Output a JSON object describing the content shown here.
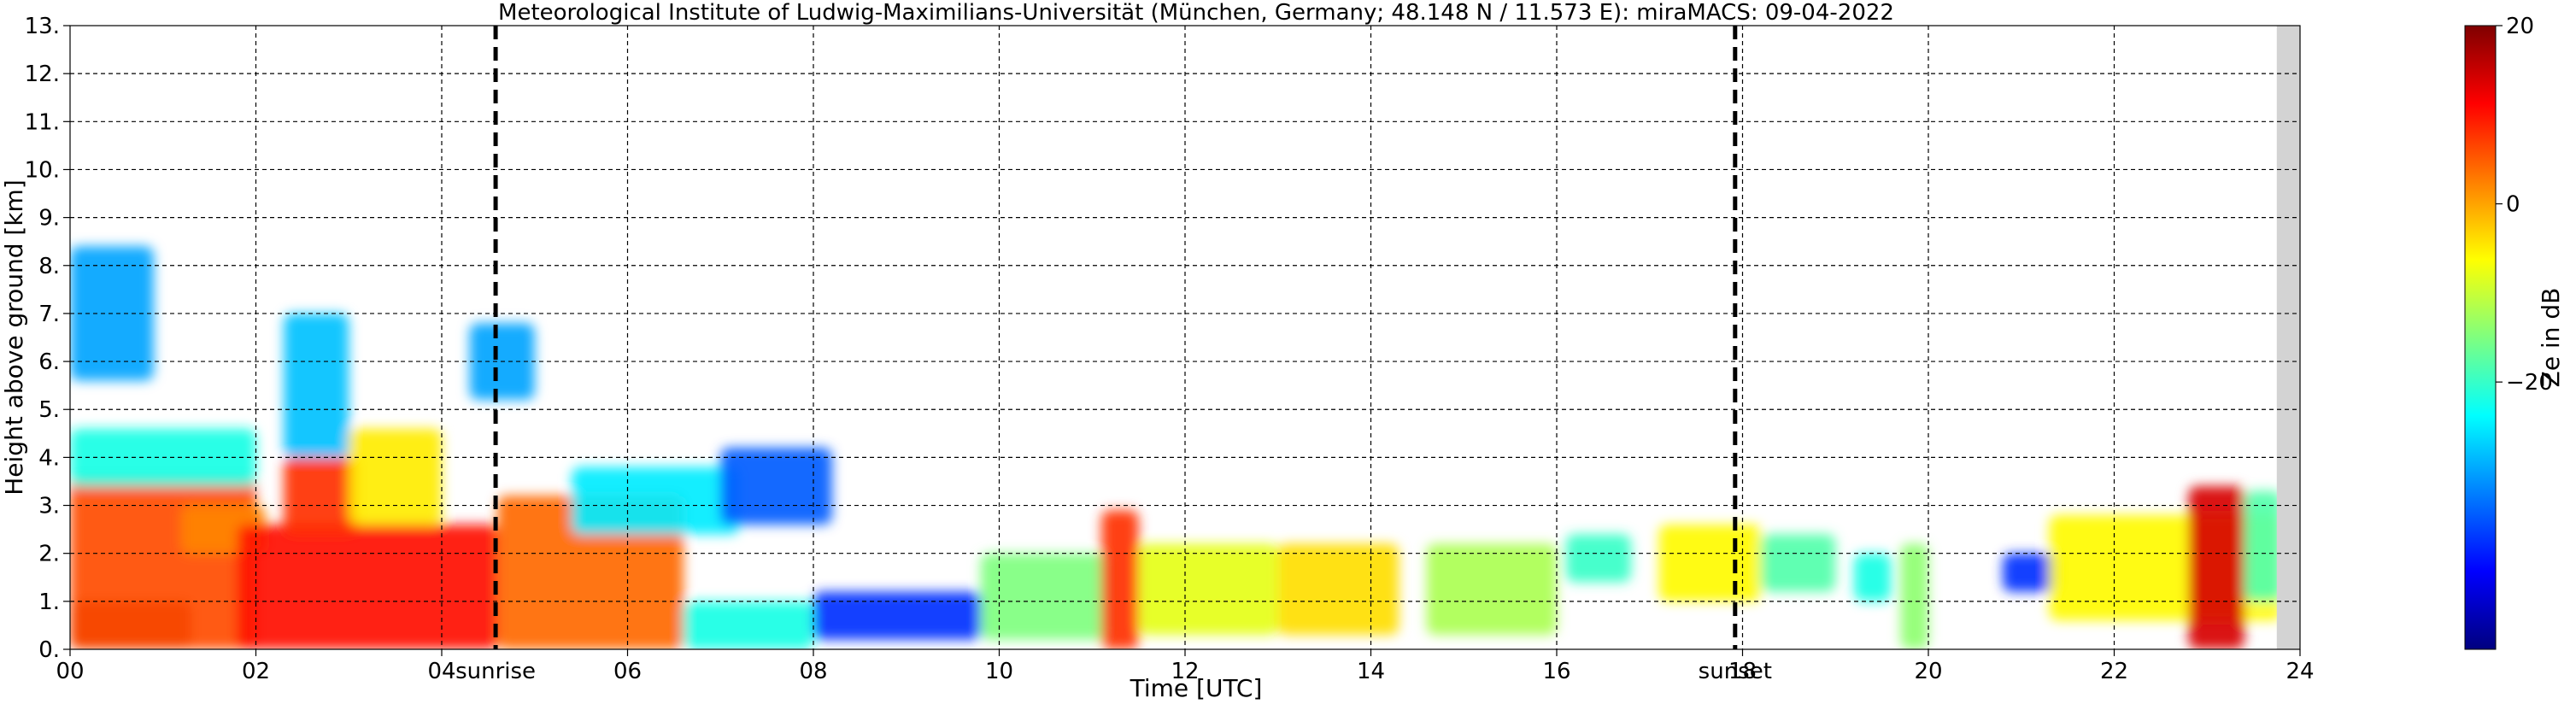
{
  "chart_data": {
    "type": "heatmap",
    "title": "Meteorological Institute of Ludwig-Maximilians-Universität (München, Germany; 48.148 N / 11.573 E):    miraMACS: 09-04-2022",
    "xlabel": "Time [UTC]",
    "ylabel": "Height above ground [km]",
    "xlim": [
      0,
      24
    ],
    "ylim": [
      0,
      13
    ],
    "x_ticks": [
      "00",
      "02",
      "04",
      "06",
      "08",
      "10",
      "12",
      "14",
      "16",
      "18",
      "20",
      "22",
      "24"
    ],
    "y_ticks": [
      "0.",
      "1.",
      "2.",
      "3.",
      "4.",
      "5.",
      "6.",
      "7.",
      "8.",
      "9.",
      "10.",
      "11.",
      "12.",
      "13."
    ],
    "grid": true,
    "no_data_after_hour": 23.75,
    "annotations": [
      {
        "label": "sunrise",
        "x": 4.58
      },
      {
        "label": "sunset",
        "x": 17.92
      }
    ],
    "colorbar": {
      "label": "Ze in dB",
      "range": [
        -50,
        20
      ],
      "ticks": [
        "20",
        "0",
        "−20"
      ],
      "tick_values": [
        20,
        0,
        -20
      ],
      "colormap": [
        "#00007f",
        "#0000ff",
        "#007fff",
        "#00ffff",
        "#7fff7f",
        "#ffff00",
        "#ff7f00",
        "#ff0000",
        "#7f0000"
      ]
    },
    "cloud_regions": [
      {
        "x0": 0.0,
        "x1": 1.3,
        "y0": 0.0,
        "y1": 1.0,
        "ze": 18
      },
      {
        "x0": 0.0,
        "x1": 2.0,
        "y0": 0.0,
        "y1": 3.6,
        "ze": 6
      },
      {
        "x0": 0.0,
        "x1": 2.0,
        "y0": 3.4,
        "y1": 4.6,
        "ze": -22
      },
      {
        "x0": 0.0,
        "x1": 0.9,
        "y0": 5.6,
        "y1": 8.4,
        "ze": -30
      },
      {
        "x0": 1.2,
        "x1": 2.1,
        "y0": 2.0,
        "y1": 3.0,
        "ze": 2
      },
      {
        "x0": 1.8,
        "x1": 4.6,
        "y0": 0.0,
        "y1": 2.6,
        "ze": 10
      },
      {
        "x0": 2.3,
        "x1": 3.1,
        "y0": 2.4,
        "y1": 4.0,
        "ze": 8
      },
      {
        "x0": 2.3,
        "x1": 3.0,
        "y0": 4.0,
        "y1": 7.0,
        "ze": -28
      },
      {
        "x0": 3.0,
        "x1": 4.0,
        "y0": 2.6,
        "y1": 4.6,
        "ze": -5
      },
      {
        "x0": 4.3,
        "x1": 5.0,
        "y0": 5.2,
        "y1": 6.8,
        "ze": -30
      },
      {
        "x0": 4.6,
        "x1": 6.6,
        "y0": 0.0,
        "y1": 3.2,
        "ze": 4
      },
      {
        "x0": 5.4,
        "x1": 7.2,
        "y0": 2.4,
        "y1": 3.8,
        "ze": -25
      },
      {
        "x0": 6.6,
        "x1": 8.0,
        "y0": 0.0,
        "y1": 1.0,
        "ze": -22
      },
      {
        "x0": 7.0,
        "x1": 8.2,
        "y0": 2.6,
        "y1": 4.2,
        "ze": -35
      },
      {
        "x0": 8.0,
        "x1": 9.8,
        "y0": 0.2,
        "y1": 1.2,
        "ze": -38
      },
      {
        "x0": 9.8,
        "x1": 11.2,
        "y0": 0.2,
        "y1": 2.0,
        "ze": -15
      },
      {
        "x0": 11.1,
        "x1": 11.5,
        "y0": 0.0,
        "y1": 2.9,
        "ze": 8
      },
      {
        "x0": 11.5,
        "x1": 13.0,
        "y0": 0.3,
        "y1": 2.2,
        "ze": -8
      },
      {
        "x0": 13.0,
        "x1": 14.3,
        "y0": 0.3,
        "y1": 2.2,
        "ze": -4
      },
      {
        "x0": 14.6,
        "x1": 16.0,
        "y0": 0.3,
        "y1": 2.2,
        "ze": -12
      },
      {
        "x0": 16.1,
        "x1": 16.8,
        "y0": 1.4,
        "y1": 2.4,
        "ze": -20
      },
      {
        "x0": 17.1,
        "x1": 18.2,
        "y0": 1.0,
        "y1": 2.6,
        "ze": -6
      },
      {
        "x0": 18.2,
        "x1": 19.0,
        "y0": 1.2,
        "y1": 2.4,
        "ze": -18
      },
      {
        "x0": 19.2,
        "x1": 19.6,
        "y0": 1.0,
        "y1": 2.0,
        "ze": -22
      },
      {
        "x0": 19.7,
        "x1": 20.0,
        "y0": 0.0,
        "y1": 2.2,
        "ze": -14
      },
      {
        "x0": 20.8,
        "x1": 21.4,
        "y0": 1.2,
        "y1": 2.0,
        "ze": -38
      },
      {
        "x0": 21.3,
        "x1": 23.8,
        "y0": 0.6,
        "y1": 2.8,
        "ze": -6
      },
      {
        "x0": 22.8,
        "x1": 23.4,
        "y0": 0.0,
        "y1": 3.4,
        "ze": 14
      },
      {
        "x0": 23.4,
        "x1": 23.8,
        "y0": 1.0,
        "y1": 3.3,
        "ze": -18
      }
    ]
  }
}
